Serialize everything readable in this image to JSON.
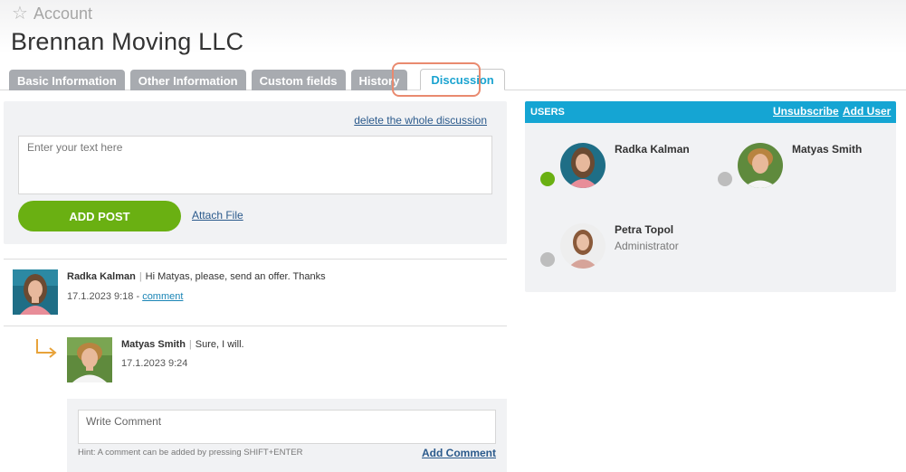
{
  "header": {
    "breadcrumb": "Account",
    "title": "Brennan Moving LLC"
  },
  "tabs": [
    {
      "label": "Basic Information",
      "active": false
    },
    {
      "label": "Other Information",
      "active": false
    },
    {
      "label": "Custom fields",
      "active": false
    },
    {
      "label": "History",
      "active": false
    },
    {
      "label": "Discussion",
      "active": true
    }
  ],
  "post_form": {
    "delete_link": "delete the whole discussion",
    "placeholder": "Enter your text here",
    "add_post_label": "ADD POST",
    "attach_label": "Attach File"
  },
  "posts": [
    {
      "author": "Radka Kalman",
      "text": "Hi Matyas, please, send an offer. Thanks",
      "time": "17.1.2023 9:18",
      "link_sep": " - ",
      "comment_link": "comment"
    },
    {
      "author": "Matyas Smith",
      "text": "Sure, I will.",
      "time": "17.1.2023 9:24"
    }
  ],
  "comment_form": {
    "placeholder": "Write Comment",
    "hint": "Hint: A comment can be added by pressing SHIFT+ENTER",
    "submit_label": "Add Comment"
  },
  "users_panel": {
    "heading": "USERS",
    "unsubscribe_label": "Unsubscribe",
    "add_user_label": "Add User",
    "users": [
      {
        "name": "Radka Kalman",
        "role": "",
        "status_color": "#6ab012"
      },
      {
        "name": "Matyas Smith",
        "role": "",
        "status_color": "#bdbdbd"
      },
      {
        "name": "Petra Topol",
        "role": "Administrator",
        "status_color": "#bdbdbd"
      }
    ]
  },
  "colors": {
    "accent": "#15a5d3",
    "primary_button": "#6ab012",
    "tab_inactive": "#a8abb0",
    "reply_arrow": "#e8a33a",
    "highlight": "#e98a6f"
  }
}
